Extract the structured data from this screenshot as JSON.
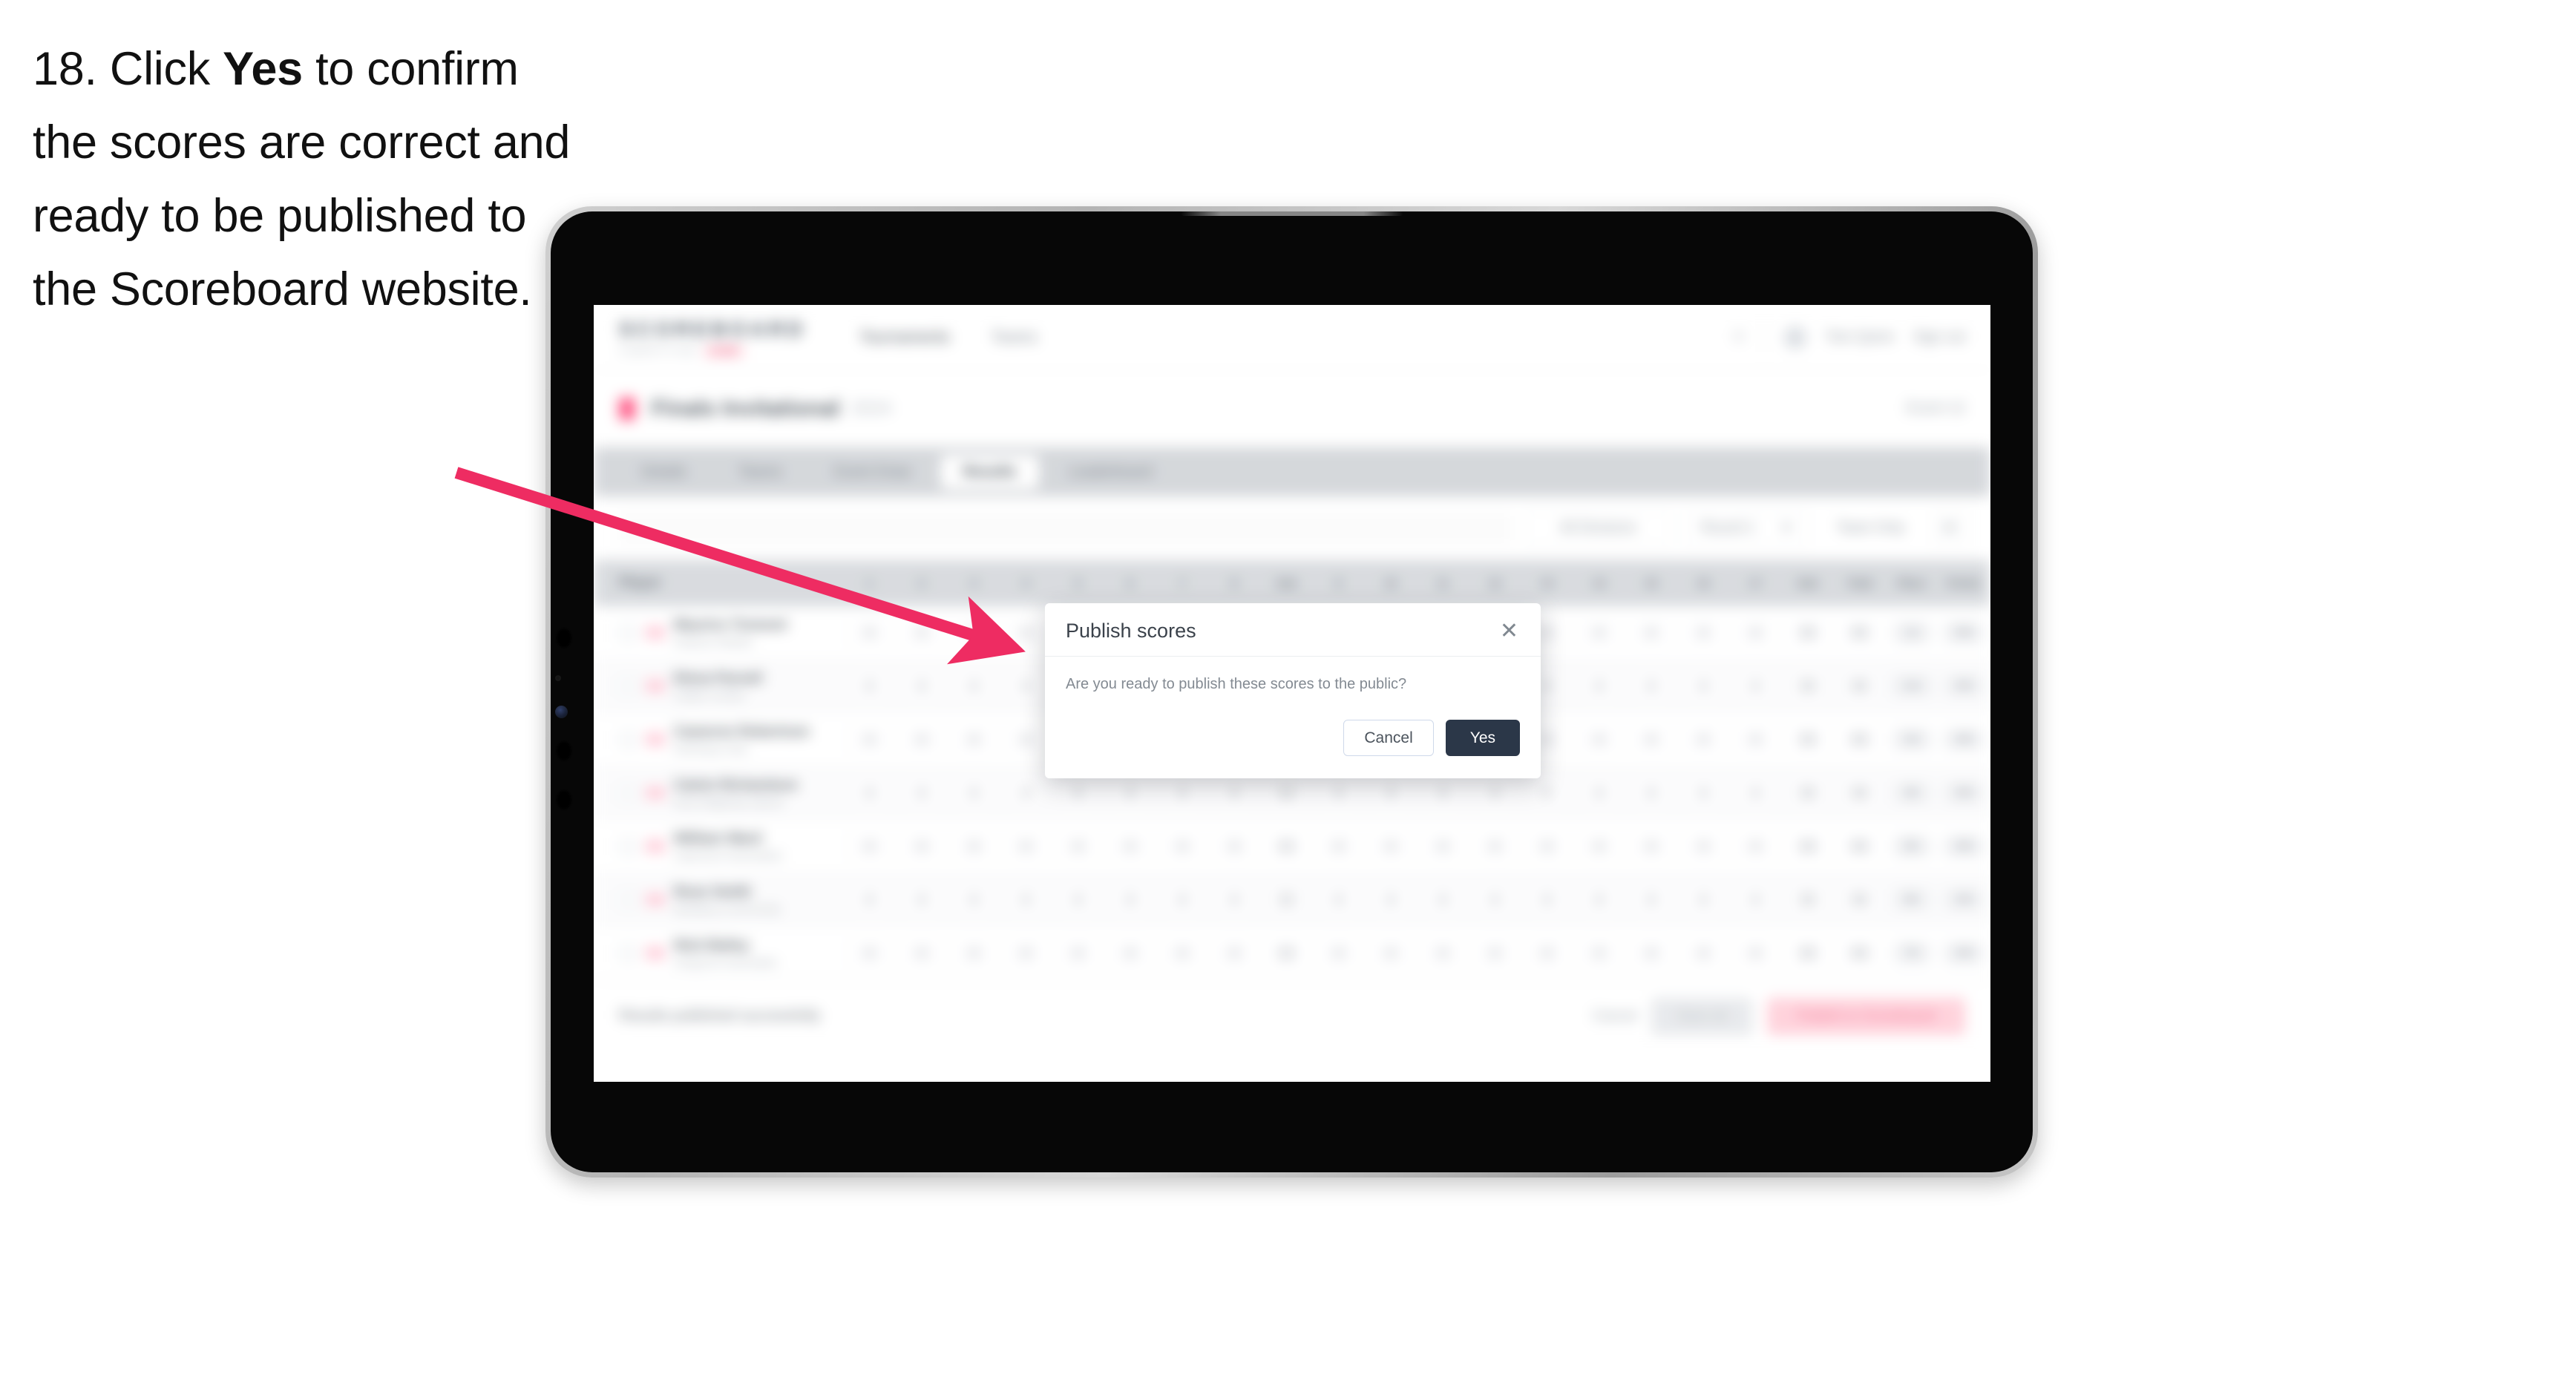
{
  "instruction": {
    "number": "18.",
    "text_before": "Click",
    "emphasis": "Yes",
    "text_after": "to confirm the scores are correct and ready to be published to the Scoreboard website."
  },
  "annotation": {
    "arrow_color": "#ee2c62",
    "arrow_start": "615,637",
    "arrow_end": "1372,874",
    "points_to": "Publish scores dialog"
  },
  "device": {
    "type": "tablet",
    "frame_color": "#b4b4b4",
    "bezel_color": "#070707"
  },
  "app": {
    "brand": {
      "name": "SCOREBOARD",
      "subtitle": "COMPETITION",
      "badge": "LIVE"
    },
    "topnav": [
      {
        "label": "Tournaments",
        "active": true
      },
      {
        "label": "Teams",
        "active": false
      }
    ],
    "topright": {
      "user": "Tom Quinn",
      "signout": "Sign out",
      "bell_icon": "bell-icon"
    },
    "title_strip": {
      "flag_icon": "flag-icon",
      "title": "Finals Invitational",
      "subtitle": "2024",
      "right_label": "Event 12"
    },
    "tabs": [
      {
        "label": "Details",
        "selected": false
      },
      {
        "label": "Teams",
        "selected": false
      },
      {
        "label": "Event Draw",
        "selected": false
      },
      {
        "label": "Results",
        "selected": true
      },
      {
        "label": "Leaderboard",
        "selected": false
      }
    ],
    "filterbar": {
      "search_placeholder": "Search",
      "filter_label": "All Divisions",
      "select_label": "Round 1",
      "sort_label": "Team Only",
      "settings_icon": "settings-icon",
      "chevron_icon": "chevron-down-icon"
    },
    "table": {
      "columns": [
        "Player",
        "1",
        "2",
        "3",
        "4",
        "5",
        "6",
        "7",
        "8",
        "Sub",
        "9",
        "10",
        "11",
        "12",
        "13",
        "14",
        "15",
        "16",
        "17",
        "Sub",
        "Total",
        "Place",
        "Points"
      ],
      "rows": [
        {
          "name": "Maurice Tremont",
          "club": "Harbour Athletic",
          "scores": [
            "4",
            "4",
            "4",
            "4",
            "4",
            "4",
            "4",
            "4",
            "32",
            "4",
            "4",
            "4",
            "4",
            "4",
            "4",
            "4",
            "4",
            "4",
            "36",
            "68"
          ],
          "place": "1st",
          "points": "500"
        },
        {
          "name": "Elena Parnell",
          "club": "Calder Cricket",
          "scores": [
            "4",
            "4",
            "4",
            "4",
            "4",
            "4",
            "4",
            "4",
            "32",
            "4",
            "4",
            "4",
            "4",
            "4",
            "4",
            "4",
            "4",
            "4",
            "36",
            "68"
          ],
          "place": "2nd",
          "points": "450"
        },
        {
          "name": "Cameron Robertson",
          "club": "Northway Club",
          "scores": [
            "4",
            "4",
            "4",
            "4",
            "4",
            "4",
            "4",
            "4",
            "32",
            "4",
            "4",
            "4",
            "4",
            "4",
            "4",
            "4",
            "4",
            "4",
            "36",
            "68"
          ],
          "place": "3rd",
          "points": "400"
        },
        {
          "name": "Calvin Richardson",
          "club": "East Ridgeway Sports",
          "scores": [
            "4",
            "4",
            "4",
            "4",
            "4",
            "4",
            "4",
            "4",
            "32",
            "4",
            "4",
            "4",
            "4",
            "4",
            "4",
            "4",
            "4",
            "4",
            "36",
            "68"
          ],
          "place": "4th",
          "points": "350"
        },
        {
          "name": "William Ward",
          "club": "Lakemoor Association",
          "scores": [
            "4",
            "4",
            "4",
            "4",
            "4",
            "4",
            "4",
            "4",
            "32",
            "4",
            "4",
            "4",
            "4",
            "4",
            "4",
            "4",
            "4",
            "4",
            "36",
            "68"
          ],
          "place": "5th",
          "points": "300"
        },
        {
          "name": "Rose Smith",
          "club": "Westbury Community",
          "scores": [
            "4",
            "4",
            "4",
            "4",
            "4",
            "4",
            "4",
            "4",
            "32",
            "4",
            "4",
            "4",
            "4",
            "4",
            "4",
            "4",
            "4",
            "4",
            "36",
            "68"
          ],
          "place": "6th",
          "points": "250"
        },
        {
          "name": "Nick Bailey",
          "club": "Ashgrove Associates",
          "scores": [
            "4",
            "4",
            "4",
            "4",
            "4",
            "4",
            "4",
            "4",
            "32",
            "4",
            "4",
            "4",
            "4",
            "4",
            "4",
            "4",
            "4",
            "4",
            "36",
            "68"
          ],
          "place": "7th",
          "points": "200"
        }
      ]
    },
    "actionbar": {
      "note": "Results published successfully",
      "link": "Cancel",
      "secondary_button": "Save all",
      "primary_button": "Publish to Scoreboard"
    }
  },
  "modal": {
    "title": "Publish scores",
    "close_icon": "close-icon",
    "message": "Are you ready to publish these scores to the public?",
    "cancel_label": "Cancel",
    "confirm_label": "Yes",
    "confirm_color": "#2b3748"
  }
}
